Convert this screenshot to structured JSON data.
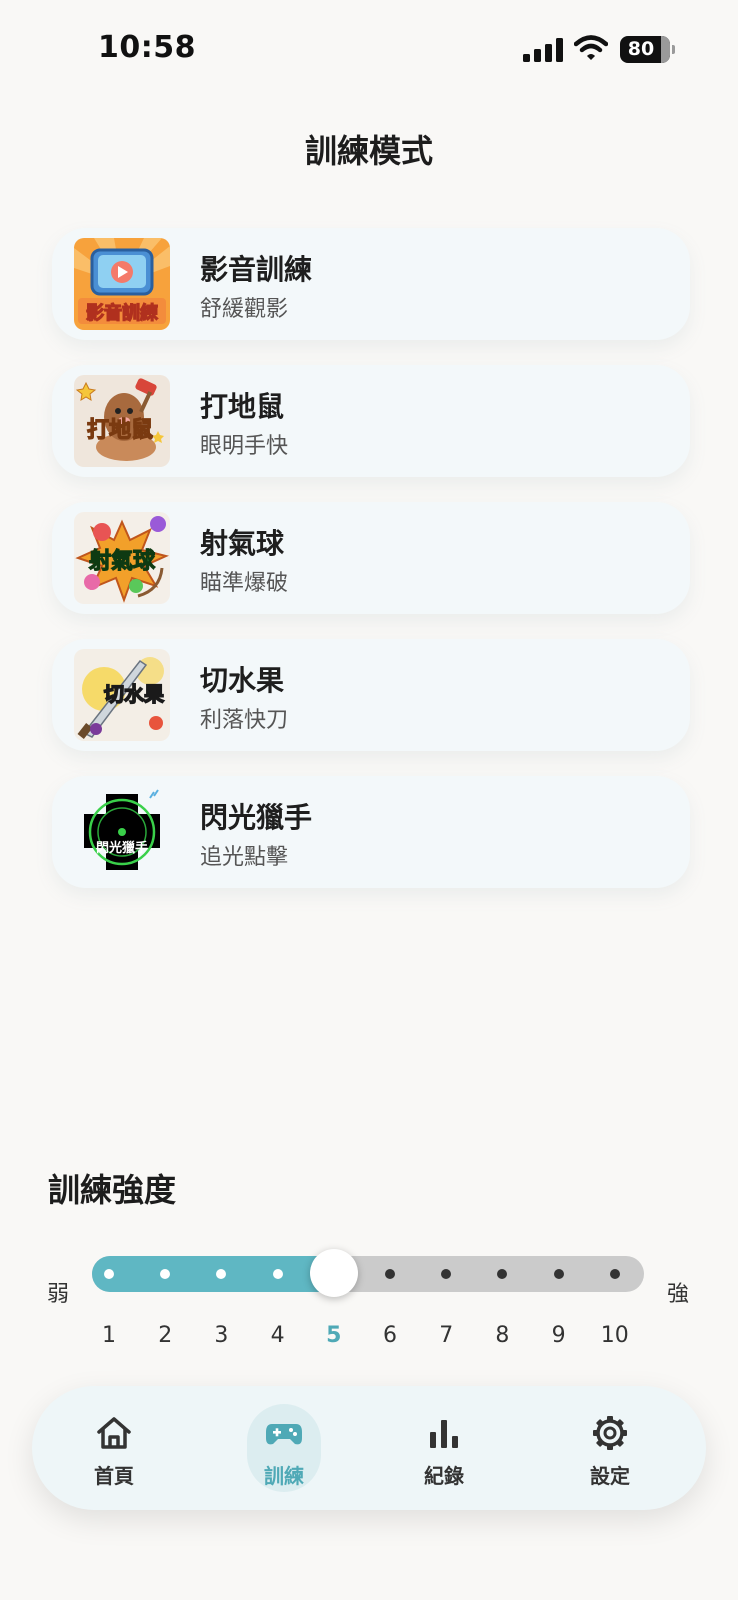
{
  "status_bar": {
    "time": "10:58",
    "battery": "80"
  },
  "page_title": "訓練模式",
  "modes": [
    {
      "name": "影音訓練",
      "desc": "舒緩觀影",
      "thumb_text": "影音訓練"
    },
    {
      "name": "打地鼠",
      "desc": "眼明手快",
      "thumb_text": "打地鼠"
    },
    {
      "name": "射氣球",
      "desc": "瞄準爆破",
      "thumb_text": "射氣球"
    },
    {
      "name": "切水果",
      "desc": "利落快刀",
      "thumb_text": "切水果"
    },
    {
      "name": "閃光獵手",
      "desc": "追光點擊",
      "thumb_text": "閃光獵手"
    }
  ],
  "intensity": {
    "title": "訓練強度",
    "min_label": "弱",
    "max_label": "強",
    "levels": [
      "1",
      "2",
      "3",
      "4",
      "5",
      "6",
      "7",
      "8",
      "9",
      "10"
    ],
    "value": 5,
    "fill_color": "#5fb7c3"
  },
  "nav": {
    "items": [
      {
        "label": "首頁",
        "icon": "home-icon"
      },
      {
        "label": "訓練",
        "icon": "gamepad-icon"
      },
      {
        "label": "紀錄",
        "icon": "bar-chart-icon"
      },
      {
        "label": "設定",
        "icon": "gear-icon"
      }
    ],
    "active_index": 1,
    "accent_color": "#4fa9b6"
  }
}
